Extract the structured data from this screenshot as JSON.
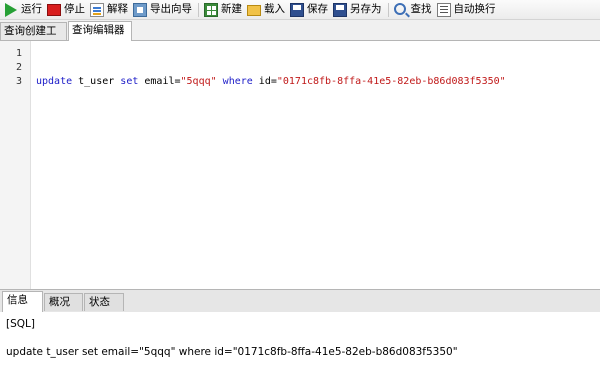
{
  "toolbar": {
    "buttons": [
      {
        "label": "运行",
        "icon": "run-icon"
      },
      {
        "label": "停止",
        "icon": "stop-icon"
      },
      {
        "label": "解释",
        "icon": "explain-icon"
      },
      {
        "label": "导出向导",
        "icon": "export-wizard-icon"
      },
      {
        "label": "新建",
        "icon": "new-icon"
      },
      {
        "label": "载入",
        "icon": "load-icon"
      },
      {
        "label": "保存",
        "icon": "save-icon"
      },
      {
        "label": "另存为",
        "icon": "save-as-icon"
      },
      {
        "label": "查找",
        "icon": "find-icon"
      },
      {
        "label": "自动换行",
        "icon": "word-wrap-icon"
      }
    ]
  },
  "editor_tabs": {
    "query_builder": "查询创建工具",
    "query_editor": "查询编辑器",
    "active": "查询编辑器"
  },
  "editor": {
    "line_numbers": [
      "1",
      "2",
      "3"
    ],
    "line3": {
      "kw_update": "update",
      "t_user": " t_user ",
      "kw_set": "set",
      "email_eq": " email=",
      "email_val": "\"5qqq\"",
      "sp": " ",
      "kw_where": "where",
      "id_eq": " id=",
      "id_val": "\"0171c8fb-8ffa-41e5-82eb-b86d083f5350\""
    }
  },
  "bottom_tabs": {
    "info": "信息",
    "overview": "概况",
    "status": "状态",
    "active": "信息"
  },
  "output": {
    "label": "[SQL]",
    "sql": "update t_user set email=\"5qqq\" where id=\"0171c8fb-8ffa-41e5-82eb-b86d083f5350\""
  }
}
